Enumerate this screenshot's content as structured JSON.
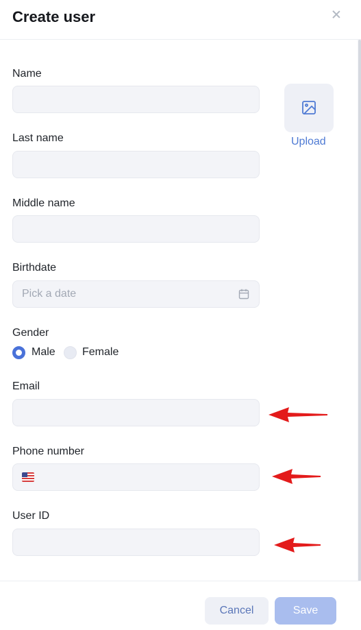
{
  "dialog": {
    "title": "Create user",
    "close_icon": "close-icon"
  },
  "form": {
    "name_label": "Name",
    "last_name_label": "Last name",
    "middle_name_label": "Middle name",
    "birthdate_label": "Birthdate",
    "birthdate_placeholder": "Pick a date",
    "gender_label": "Gender",
    "gender_options": [
      {
        "label": "Male",
        "selected": true
      },
      {
        "label": "Female",
        "selected": false
      }
    ],
    "email_label": "Email",
    "phone_label": "Phone number",
    "phone_country_flag": "us-flag-icon",
    "user_id_label": "User ID"
  },
  "avatar": {
    "upload_label": "Upload",
    "icon": "image-icon"
  },
  "footer": {
    "cancel_label": "Cancel",
    "save_label": "Save"
  },
  "colors": {
    "accent": "#4a72d9",
    "annotation_arrow": "#e31b1b",
    "save_disabled": "#a9bdee"
  }
}
